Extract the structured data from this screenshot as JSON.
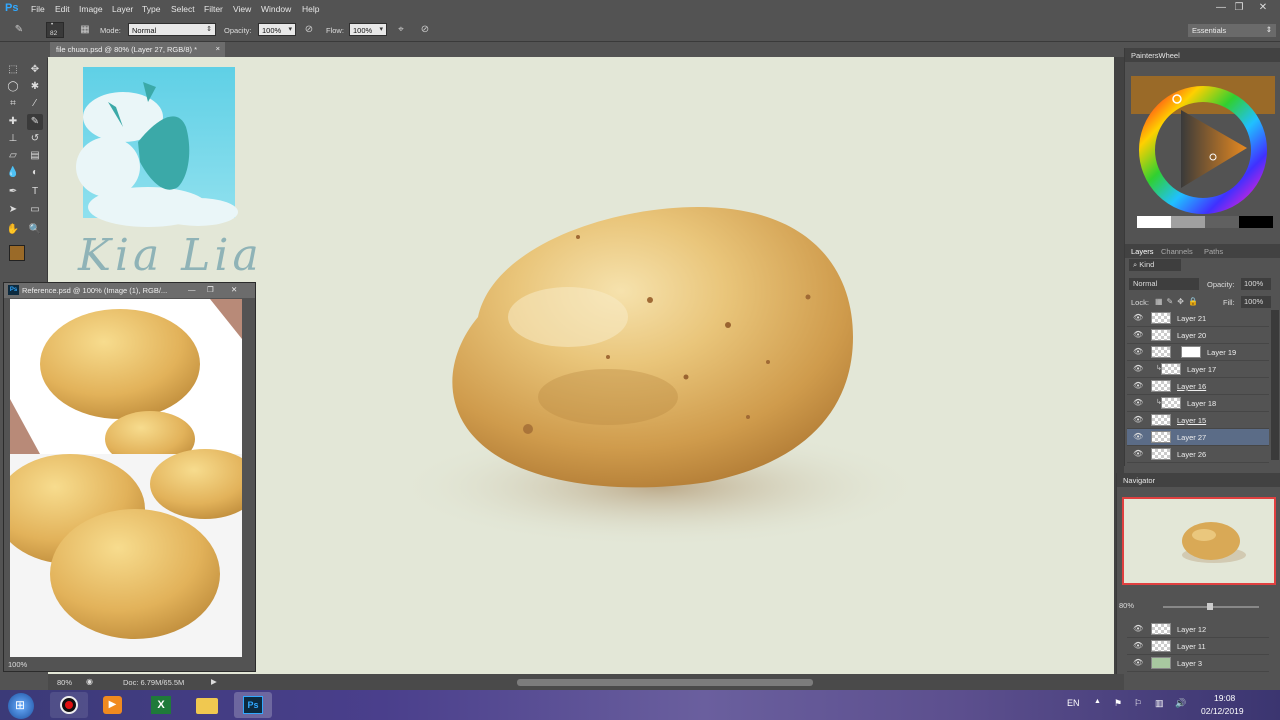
{
  "app": {
    "logo": "Ps",
    "menu": [
      "File",
      "Edit",
      "Image",
      "Layer",
      "Type",
      "Select",
      "Filter",
      "View",
      "Window",
      "Help"
    ],
    "window_controls": [
      "—",
      "❐",
      "✕"
    ]
  },
  "options_bar": {
    "brush_size": "82",
    "mode_label": "Mode:",
    "mode_value": "Normal",
    "opacity_label": "Opacity:",
    "opacity_value": "100%",
    "flow_label": "Flow:",
    "flow_value": "100%",
    "workspace": "Essentials"
  },
  "document": {
    "tab_title": "file chuan.psd @ 80% (Layer 27, RGB/8) *",
    "tab_close": "×",
    "zoom": "80%",
    "doc_size": "Doc: 6.79M/65.5M",
    "canvas_color": "#e3e7d7",
    "watermark_text": "Kia Lia"
  },
  "colors": {
    "foreground": "#9a6a28",
    "background": "#b8865a",
    "accent_selected_layer": "#5b6c87"
  },
  "reference_window": {
    "title": "Reference.psd @ 100% (Image (1), RGB/...",
    "zoom": "100%",
    "controls": [
      "—",
      "❐",
      "✕"
    ]
  },
  "painters_wheel": {
    "title": "PaintersWheel"
  },
  "layers_panel": {
    "tabs": [
      "Layers",
      "Channels",
      "Paths"
    ],
    "filter_kind": "Kind",
    "blend_mode": "Normal",
    "opacity_label": "Opacity:",
    "opacity_value": "100%",
    "lock_label": "Lock:",
    "fill_label": "Fill:",
    "fill_value": "100%",
    "layers": [
      {
        "name": "Layer 21",
        "selected": false
      },
      {
        "name": "Layer 20",
        "selected": false
      },
      {
        "name": "Layer 19",
        "selected": false
      },
      {
        "name": "Layer 17",
        "selected": false
      },
      {
        "name": "Layer 16",
        "selected": false
      },
      {
        "name": "Layer 18",
        "selected": false
      },
      {
        "name": "Layer 15",
        "selected": false
      },
      {
        "name": "Layer 27",
        "selected": true
      },
      {
        "name": "Layer 26",
        "selected": false
      }
    ],
    "lower_layers": [
      {
        "name": "Layer 12"
      },
      {
        "name": "Layer 11"
      },
      {
        "name": "Layer 3"
      }
    ]
  },
  "navigator": {
    "title": "Navigator",
    "zoom": "80%"
  },
  "taskbar": {
    "language": "EN",
    "time": "19:08",
    "date": "02/12/2019"
  }
}
